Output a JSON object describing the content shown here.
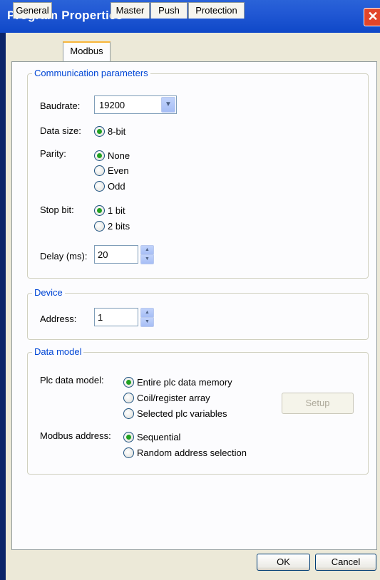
{
  "window": {
    "title": "Program Properties",
    "close_icon": "close-icon"
  },
  "tabs": [
    {
      "label": "General"
    },
    {
      "label": "Modbus",
      "active": true
    },
    {
      "label": "Master"
    },
    {
      "label": "Push"
    },
    {
      "label": "Protection"
    }
  ],
  "communication": {
    "title": "Communication parameters",
    "baudrate_label": "Baudrate:",
    "baudrate_value": "19200",
    "data_size_label": "Data size:",
    "data_size_option": "8-bit",
    "parity_label": "Parity:",
    "parity_options": [
      "None",
      "Even",
      "Odd"
    ],
    "parity_selected": "None",
    "stop_bit_label": "Stop bit:",
    "stop_bit_options": [
      "1 bit",
      "2 bits"
    ],
    "stop_bit_selected": "1 bit",
    "delay_label": "Delay (ms):",
    "delay_value": "20"
  },
  "device": {
    "title": "Device",
    "address_label": "Address:",
    "address_value": "1"
  },
  "data_model": {
    "title": "Data model",
    "plc_label": "Plc data model:",
    "plc_options": [
      "Entire plc data memory",
      "Coil/register array",
      "Selected plc variables"
    ],
    "plc_selected": "Entire plc data memory",
    "setup_label": "Setup",
    "modbus_label": "Modbus address:",
    "modbus_options": [
      "Sequential",
      "Random address selection"
    ],
    "modbus_selected": "Sequential"
  },
  "footer": {
    "ok_label": "OK",
    "cancel_label": "Cancel"
  },
  "colors": {
    "title_bar": "#2158d4",
    "group_title": "#0046d5",
    "radio_dot": "#21a121",
    "tab_highlight": "#f9b63b"
  }
}
